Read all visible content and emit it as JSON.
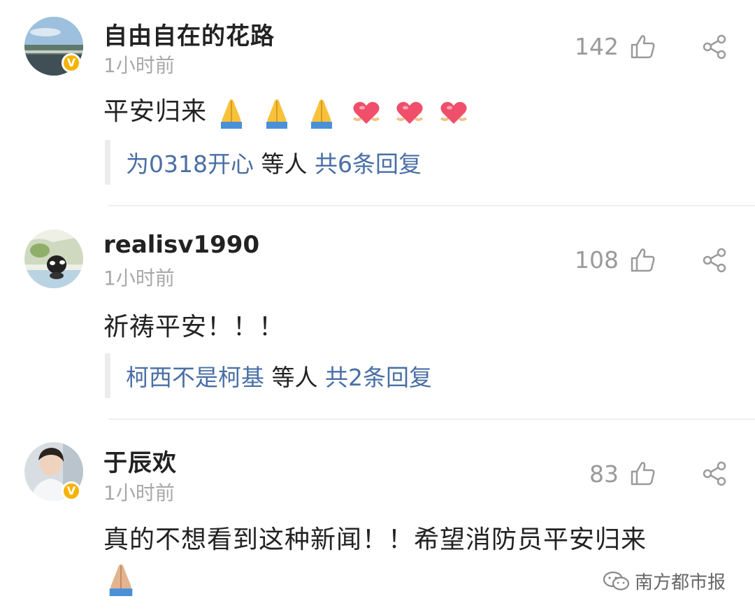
{
  "comments": [
    {
      "username": "自由自在的花路",
      "time": "1小时前",
      "likes": "142",
      "content": "平安归来",
      "emojis": [
        "folded-hands",
        "folded-hands",
        "folded-hands",
        "heart-hands",
        "heart-hands",
        "heart-hands"
      ],
      "reply": {
        "user": "为0318开心",
        "middle": "等人",
        "count": "共6条回复"
      },
      "verified": true
    },
    {
      "username": "realisv1990",
      "time": "1小时前",
      "likes": "108",
      "content": "祈祷平安！！！",
      "emojis": [],
      "reply": {
        "user": "柯西不是柯基",
        "middle": "等人",
        "count": "共2条回复"
      },
      "verified": false
    },
    {
      "username": "于辰欢",
      "time": "1小时前",
      "likes": "83",
      "content": "真的不想看到这种新闻！！希望消防员平安归来",
      "emojis": [
        "folded-hands-light"
      ],
      "verified": true
    }
  ],
  "watermark": "南方都市报",
  "colors": {
    "link": "#4a6fa5",
    "meta": "#a8a8a8",
    "badge": "#f5b400"
  }
}
